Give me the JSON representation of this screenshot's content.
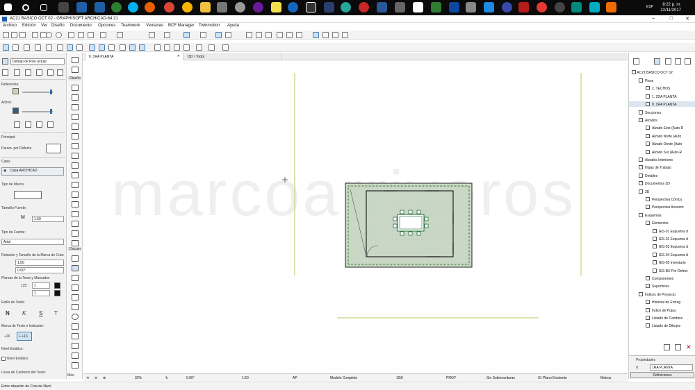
{
  "taskbar": {
    "clock_time": "8:22 p. m.",
    "clock_date": "22/11/2017",
    "lang": "ESP"
  },
  "window": {
    "title": "AC21 BASICO OCT 02 - GRAPHISOFT ARCHICAD-64 21"
  },
  "menu": [
    "Archivo",
    "Edición",
    "Ver",
    "Diseño",
    "Documento",
    "Opciones",
    "Teamwork",
    "Ventanas",
    "BCF Manager",
    "Twinmotion",
    "Ayuda"
  ],
  "infobox": {
    "header_label": "Debajo de Piso actual",
    "ref_label": "Referencia:",
    "active_label": "Activo:",
    "main_label": "Principal:",
    "param_label": "Param. por Defecto",
    "layer_label": "Capa:",
    "layer_value": "Capa ARCHICAD",
    "mark_type_label": "Tipo de Marca:",
    "font_size_label": "Tamaño Fuente:",
    "font_size_value": "1.50",
    "font_type_label": "Tipo de Fuente:",
    "font_value": "Arial",
    "rotation_label": "Rotación y Tamaño de la Marca de Cota:",
    "rotation_size": "1.50",
    "rotation_angle": "0.00°",
    "pens_label": "Plumas de la Texto y Marcador:",
    "pen_value_a": "125",
    "pen_value_b": "1",
    "pen_value_c": "1",
    "text_style_label": "Estilo de Texto:",
    "style_buttons": [
      "N",
      "K",
      "S",
      "T"
    ],
    "text_mark_label": "Marca de Texto e Indicador:",
    "mark_btn_a": "+16",
    "mark_btn_b": "+ +16",
    "level_label": "Nivel Estático:",
    "level_check": "Nivel Estático",
    "contour_label": "Línea de Contorno del Texto:",
    "more_label": "Más"
  },
  "toolbox": {
    "design_label": "Diseño",
    "document_label": "Docum"
  },
  "tabs": [
    {
      "label": "0. 1RA PLANTA"
    },
    {
      "label": "[3D / Todo]"
    }
  ],
  "status": {
    "zoom": "32%",
    "angle": "0.00°",
    "scale": "1:50",
    "pen_set": "AP",
    "model": "Modelo Completo",
    "dim_scale": "1/50",
    "proj": "PROY",
    "overrides": "Sin Sobrescrituras",
    "plan": "01 Plano Existente",
    "units": "Metros"
  },
  "hint": "Entre situación de Cota de Nivel.",
  "watermark": "marcoarriveros",
  "navigator": {
    "root": "AC21 BASICO OCT 02",
    "items": [
      {
        "label": "Pisos",
        "indent": 1
      },
      {
        "label": "2. TECHOS",
        "indent": 2
      },
      {
        "label": "1. 2DA PLANTA",
        "indent": 2
      },
      {
        "label": "0. 1RA PLANTA",
        "indent": 2,
        "selected": true
      },
      {
        "label": "Secciones",
        "indent": 1
      },
      {
        "label": "Alzados",
        "indent": 1
      },
      {
        "label": "Alzado Este (Auto-R",
        "indent": 2
      },
      {
        "label": "Alzado Norte (Auto",
        "indent": 2
      },
      {
        "label": "Alzado Oeste (Auto",
        "indent": 2
      },
      {
        "label": "Alzado Sur (Auto-R",
        "indent": 2
      },
      {
        "label": "Alzados Interiores",
        "indent": 1
      },
      {
        "label": "Hojas de Trabajo",
        "indent": 1
      },
      {
        "label": "Detalles",
        "indent": 1
      },
      {
        "label": "Documentos 3D",
        "indent": 1
      },
      {
        "label": "3D",
        "indent": 1
      },
      {
        "label": "Perspectiva Cónica",
        "indent": 2
      },
      {
        "label": "Perspectiva Axonom",
        "indent": 2
      },
      {
        "label": "Esquemas",
        "indent": 1
      },
      {
        "label": "Elementos",
        "indent": 2
      },
      {
        "label": "IES-01 Esquema d",
        "indent": 3
      },
      {
        "label": "IES-02 Esquema d",
        "indent": 3
      },
      {
        "label": "IES-03 Esquema d",
        "indent": 3
      },
      {
        "label": "IES-04 Esquema d",
        "indent": 3
      },
      {
        "label": "IES-05 Inventario",
        "indent": 3
      },
      {
        "label": "IES-BX Por Defect",
        "indent": 3
      },
      {
        "label": "Componentes",
        "indent": 2
      },
      {
        "label": "Superficies",
        "indent": 2
      },
      {
        "label": "Índices de Proyecto",
        "indent": 1
      },
      {
        "label": "Historial de Entreg",
        "indent": 2
      },
      {
        "label": "Índice de Hojas",
        "indent": 2
      },
      {
        "label": "Listado de Cambios",
        "indent": 2
      },
      {
        "label": "Listado de Dibujos",
        "indent": 2
      }
    ],
    "props_label": "Propiedades",
    "props_id": "0.",
    "props_value": "1RA PLANTA",
    "definitions_label": "Definiciones"
  },
  "colors": {
    "accent": "#2c6db1",
    "selection": "#dde6ef",
    "grid_line": "#b9c85a"
  }
}
